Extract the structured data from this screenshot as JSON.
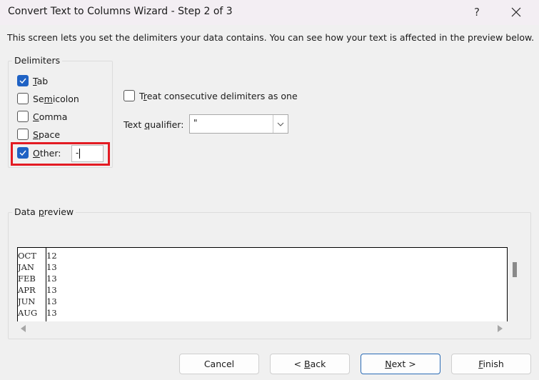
{
  "window": {
    "title": "Convert Text to Columns Wizard - Step 2 of 3",
    "help_label": "?",
    "close_icon": "close-icon"
  },
  "intro_text": "This screen lets you set the delimiters your data contains.  You can see how your text is affected in the preview below.",
  "delimiters": {
    "group_label": "Delimiters",
    "items": [
      {
        "pre": "",
        "mn": "T",
        "post": "ab",
        "checked": true
      },
      {
        "pre": "Se",
        "mn": "m",
        "post": "icolon",
        "checked": false
      },
      {
        "pre": "",
        "mn": "C",
        "post": "omma",
        "checked": false
      },
      {
        "pre": "",
        "mn": "S",
        "post": "pace",
        "checked": false
      },
      {
        "pre": "",
        "mn": "O",
        "post": "ther:",
        "checked": true
      }
    ],
    "other_value": "-"
  },
  "options": {
    "treat_consecutive": {
      "pre": "T",
      "mn": "r",
      "post": "eat consecutive delimiters as one",
      "checked": false
    },
    "text_qualifier": {
      "pre": "Text ",
      "mn": "q",
      "post": "ualifier:",
      "value": "\""
    }
  },
  "preview": {
    "group_label_pre": "Data ",
    "group_label_mn": "p",
    "group_label_post": "review",
    "rows": [
      [
        "OCT",
        "12"
      ],
      [
        "JAN",
        "13"
      ],
      [
        "FEB",
        "13"
      ],
      [
        "APR",
        "13"
      ],
      [
        "JUN",
        "13"
      ],
      [
        "AUG",
        "13"
      ]
    ]
  },
  "buttons": {
    "cancel": "Cancel",
    "back": {
      "pre": "< ",
      "mn": "B",
      "post": "ack"
    },
    "next": {
      "pre": "",
      "mn": "N",
      "post": "ext >"
    },
    "finish": {
      "pre": "",
      "mn": "F",
      "post": "inish"
    }
  },
  "colors": {
    "accent": "#1f62c4",
    "highlight": "#e31b23"
  }
}
